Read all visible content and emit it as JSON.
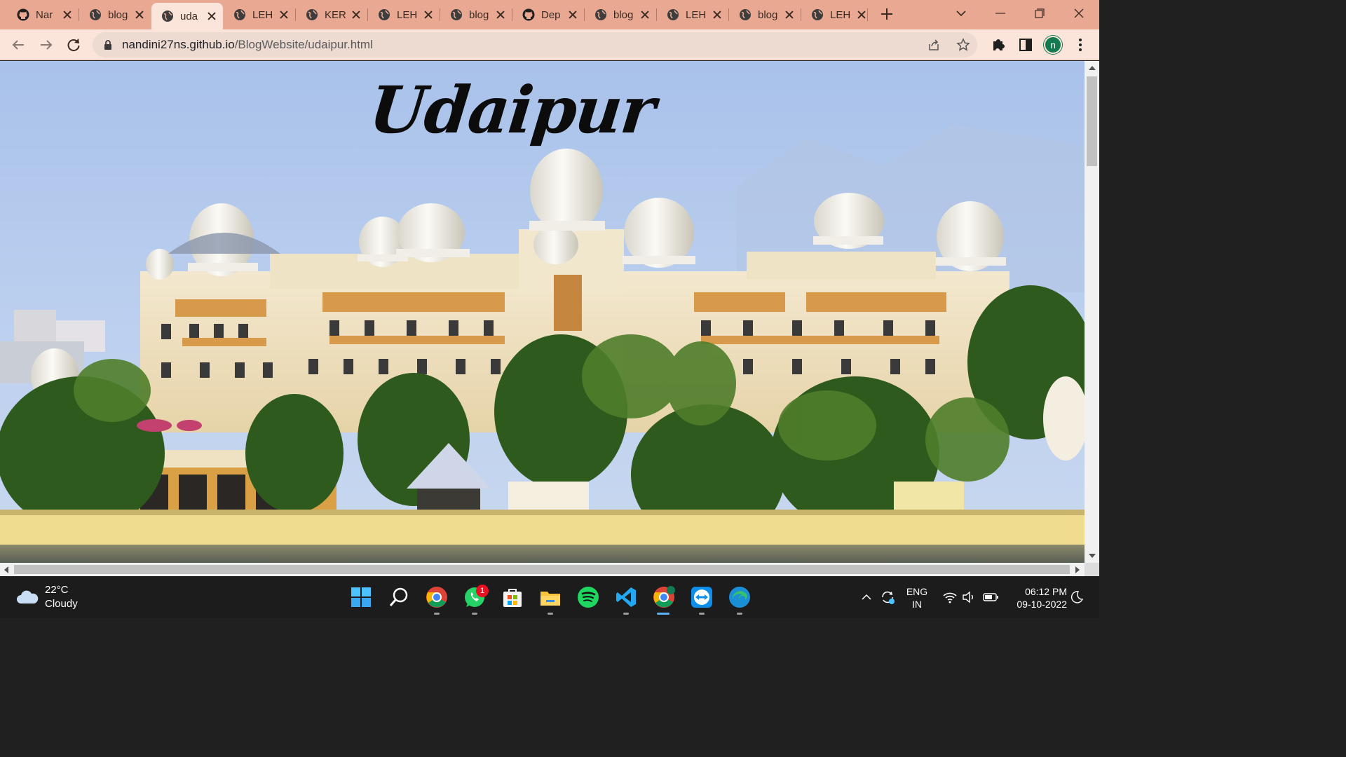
{
  "browser": {
    "tabs": [
      {
        "title": "Nar",
        "favicon": "github-icon",
        "active": false
      },
      {
        "title": "blog",
        "favicon": "globe-icon",
        "active": false
      },
      {
        "title": "uda",
        "favicon": "globe-icon",
        "active": true
      },
      {
        "title": "LEH",
        "favicon": "globe-icon",
        "active": false
      },
      {
        "title": "KER",
        "favicon": "globe-icon",
        "active": false
      },
      {
        "title": "LEH",
        "favicon": "globe-icon",
        "active": false
      },
      {
        "title": "blog",
        "favicon": "globe-icon",
        "active": false
      },
      {
        "title": "Dep",
        "favicon": "github-icon",
        "active": false
      },
      {
        "title": "blog",
        "favicon": "globe-icon",
        "active": false
      },
      {
        "title": "LEH",
        "favicon": "globe-icon",
        "active": false
      },
      {
        "title": "blog",
        "favicon": "globe-icon",
        "active": false
      },
      {
        "title": "LEH",
        "favicon": "globe-icon",
        "active": false
      }
    ],
    "address": {
      "host": "nandini27ns.github.io",
      "path": "/BlogWebsite/udaipur.html"
    },
    "profile_initial": "n",
    "colors": {
      "frame": "#e8a891",
      "toolbar": "#fbe4da",
      "profile": "#137a51"
    }
  },
  "page": {
    "heading": "Udaipur",
    "hero_image": "lakeside-palace-hotel-photo"
  },
  "taskbar": {
    "weather": {
      "temp": "22°C",
      "condition": "Cloudy",
      "icon": "cloud-icon"
    },
    "apps": [
      {
        "name": "start-icon"
      },
      {
        "name": "search-icon"
      },
      {
        "name": "chrome-icon"
      },
      {
        "name": "whatsapp-icon",
        "badge": "1"
      },
      {
        "name": "microsoft-store-icon"
      },
      {
        "name": "file-explorer-icon"
      },
      {
        "name": "spotify-icon"
      },
      {
        "name": "vscode-icon"
      },
      {
        "name": "chrome-profile-icon"
      },
      {
        "name": "teamviewer-icon"
      },
      {
        "name": "edge-icon"
      }
    ],
    "language": {
      "line1": "ENG",
      "line2": "IN"
    },
    "clock": {
      "time": "06:12 PM",
      "date": "09-10-2022"
    }
  }
}
